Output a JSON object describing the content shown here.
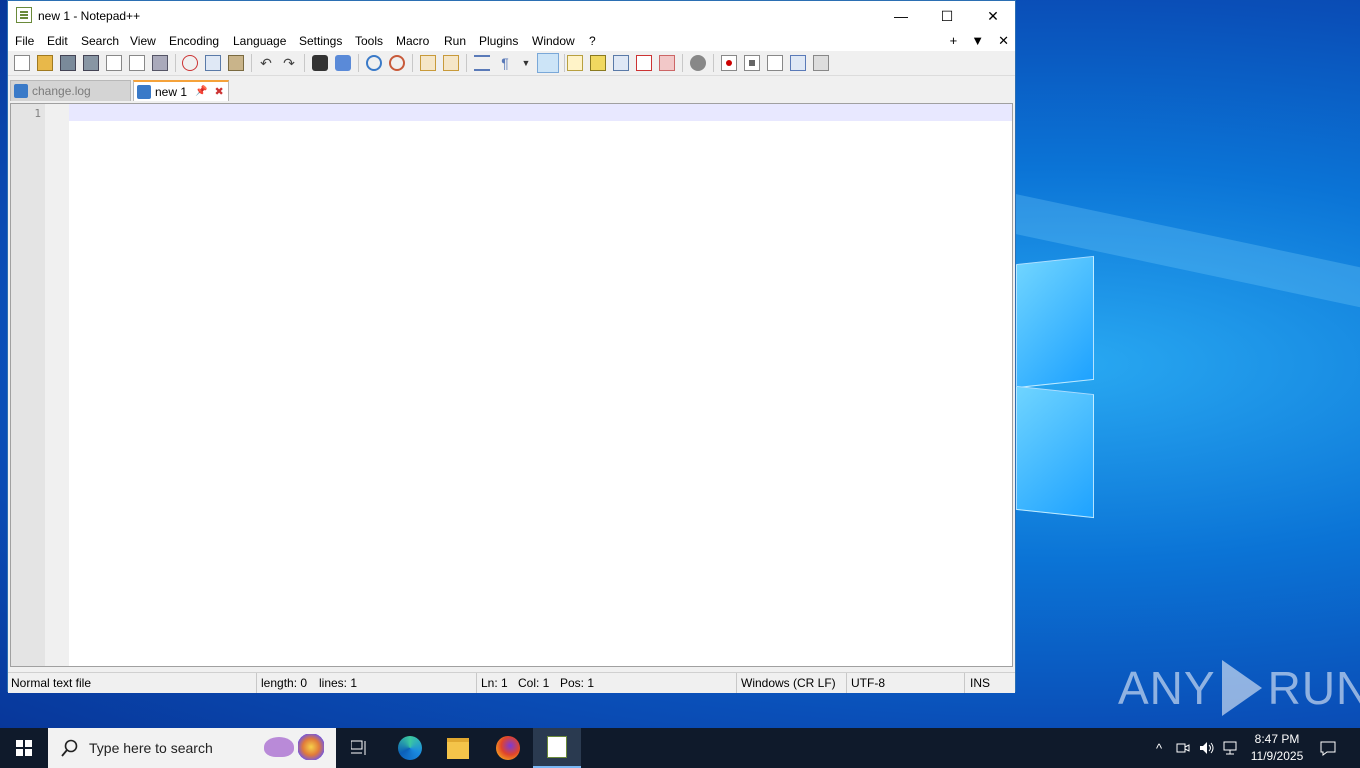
{
  "window": {
    "title": "new 1 - Notepad++",
    "caption": {
      "minimize": "—",
      "maximize": "☐",
      "close": "✕"
    }
  },
  "menu": {
    "items": [
      "File",
      "Edit",
      "Search",
      "View",
      "Encoding",
      "Language",
      "Settings",
      "Tools",
      "Macro",
      "Run",
      "Plugins",
      "Window",
      "?"
    ],
    "right": {
      "add": "+",
      "dropdown": "▼",
      "close": "✕"
    }
  },
  "toolbar": {
    "icons": [
      "new-file-icon",
      "open-file-icon",
      "save-icon",
      "save-all-icon",
      "close-icon",
      "close-all-icon",
      "print-icon",
      "cut-icon",
      "copy-icon",
      "paste-icon",
      "undo-icon",
      "redo-icon",
      "find-icon",
      "replace-icon",
      "zoom-in-icon",
      "zoom-out-icon",
      "sync-vertical-icon",
      "sync-horizontal-icon",
      "word-wrap-icon",
      "show-all-chars-icon",
      "indent-guide-icon",
      "doc-map-icon",
      "function-list-icon",
      "folder-workspace-icon",
      "monitoring-icon",
      "record-macro-icon",
      "stop-macro-icon",
      "play-macro-icon",
      "run-macro-multiple-icon",
      "save-macro-icon"
    ]
  },
  "tabs": [
    {
      "label": "change.log",
      "active": false
    },
    {
      "label": "new 1",
      "active": true,
      "pin": "📌",
      "close": "✖"
    }
  ],
  "editor": {
    "line_numbers": [
      "1"
    ],
    "content": ""
  },
  "status": {
    "file_type": "Normal text file",
    "length": "length: 0",
    "lines": "lines: 1",
    "ln": "Ln: 1",
    "col": "Col: 1",
    "pos": "Pos: 1",
    "eol": "Windows (CR LF)",
    "encoding": "UTF-8",
    "mode": "INS"
  },
  "taskbar": {
    "search_placeholder": "Type here to search",
    "time": "8:47 PM",
    "date": "11/9/2025"
  },
  "watermark": {
    "left": "ANY",
    "right": "RUN"
  },
  "colors": {
    "desktop": "#0b74d6",
    "taskbar": "#0f1a2b",
    "tab_accent": "#f5a23a",
    "current_line": "#e8e8ff"
  }
}
